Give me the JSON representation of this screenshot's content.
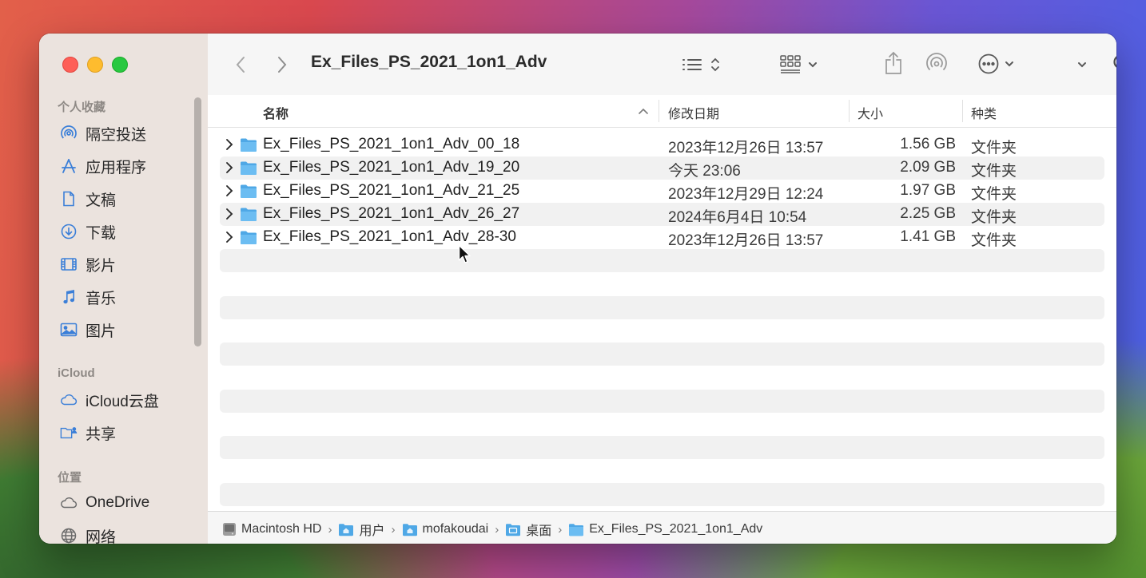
{
  "window": {
    "title": "Ex_Files_PS_2021_1on1_Adv"
  },
  "sidebar": {
    "favorites_header": "个人收藏",
    "favorites": [
      {
        "label": "隔空投送",
        "icon": "airdrop-icon"
      },
      {
        "label": "应用程序",
        "icon": "applications-icon"
      },
      {
        "label": "文稿",
        "icon": "document-icon"
      },
      {
        "label": "下载",
        "icon": "download-icon"
      },
      {
        "label": "影片",
        "icon": "movies-icon"
      },
      {
        "label": "音乐",
        "icon": "music-icon"
      },
      {
        "label": "图片",
        "icon": "pictures-icon"
      }
    ],
    "icloud_header": "iCloud",
    "icloud": [
      {
        "label": "iCloud云盘",
        "icon": "icloud-icon"
      },
      {
        "label": "共享",
        "icon": "shared-folder-icon"
      }
    ],
    "locations_header": "位置",
    "locations": [
      {
        "label": "OneDrive",
        "icon": "cloud-icon"
      },
      {
        "label": "网络",
        "icon": "network-icon"
      }
    ]
  },
  "columns": {
    "name": "名称",
    "date": "修改日期",
    "size": "大小",
    "kind": "种类"
  },
  "rows": [
    {
      "name": "Ex_Files_PS_2021_1on1_Adv_00_18",
      "date": "2023年12月26日 13:57",
      "size": "1.56 GB",
      "kind": "文件夹"
    },
    {
      "name": "Ex_Files_PS_2021_1on1_Adv_19_20",
      "date": "今天 23:06",
      "size": "2.09 GB",
      "kind": "文件夹"
    },
    {
      "name": "Ex_Files_PS_2021_1on1_Adv_21_25",
      "date": "2023年12月29日 12:24",
      "size": "1.97 GB",
      "kind": "文件夹"
    },
    {
      "name": "Ex_Files_PS_2021_1on1_Adv_26_27",
      "date": "2024年6月4日 10:54",
      "size": "2.25 GB",
      "kind": "文件夹"
    },
    {
      "name": "Ex_Files_PS_2021_1on1_Adv_28-30",
      "date": "2023年12月26日 13:57",
      "size": "1.41 GB",
      "kind": "文件夹"
    }
  ],
  "pathbar": [
    "Macintosh HD",
    "用户",
    "mofakoudai",
    "桌面",
    "Ex_Files_PS_2021_1on1_Adv"
  ],
  "colors": {
    "folder": "#4fa8e6",
    "accent": "#2f7de1"
  }
}
